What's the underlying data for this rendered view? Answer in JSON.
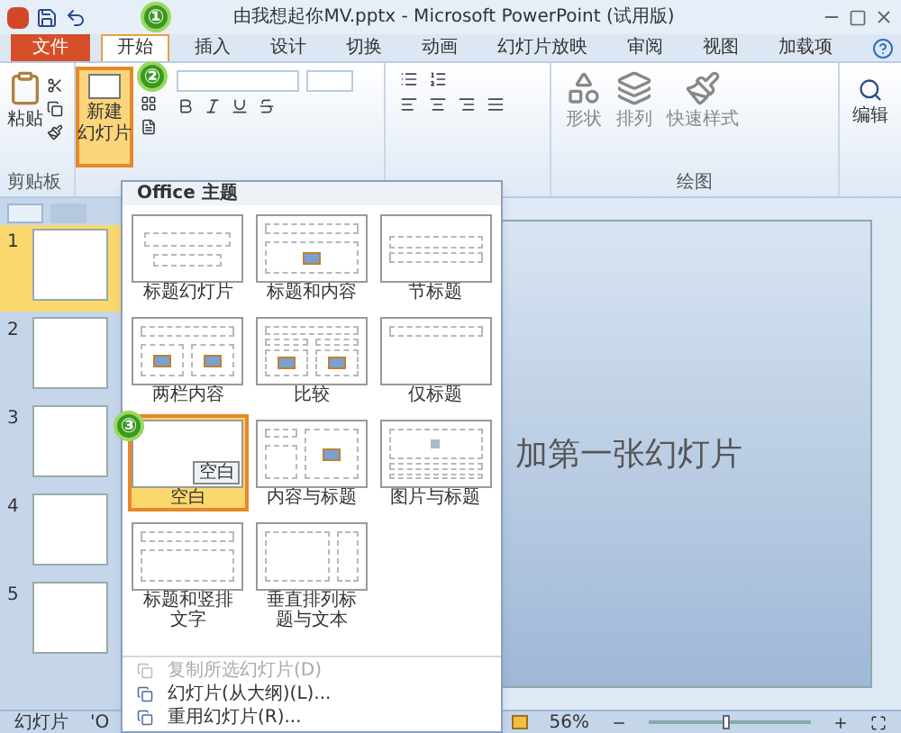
{
  "window": {
    "title": "由我想起你MV.pptx - Microsoft PowerPoint (试用版)"
  },
  "ribbon_tabs": [
    {
      "label": "文件",
      "kind": "file",
      "selected": false
    },
    {
      "label": "开始",
      "kind": "tab",
      "selected": true
    },
    {
      "label": "插入",
      "kind": "tab",
      "selected": false
    },
    {
      "label": "设计",
      "kind": "tab",
      "selected": false
    },
    {
      "label": "切换",
      "kind": "tab",
      "selected": false
    },
    {
      "label": "动画",
      "kind": "tab",
      "selected": false
    },
    {
      "label": "幻灯片放映",
      "kind": "tab",
      "selected": false
    },
    {
      "label": "审阅",
      "kind": "tab",
      "selected": false
    },
    {
      "label": "视图",
      "kind": "tab",
      "selected": false
    },
    {
      "label": "加载项",
      "kind": "tab",
      "selected": false
    }
  ],
  "clipboard_group": {
    "paste": "粘贴",
    "label": "剪贴板"
  },
  "new_slide_button": {
    "lines": [
      "新建",
      "幻灯片"
    ],
    "selected": true
  },
  "drawing_group": {
    "buttons": [
      "形状",
      "排列",
      "快速样式"
    ],
    "label": "绘图"
  },
  "editing_button": "编辑",
  "slide_panel": {
    "slides": [
      {
        "number": "1",
        "selected": true
      },
      {
        "number": "2",
        "selected": false
      },
      {
        "number": "3",
        "selected": false
      },
      {
        "number": "4",
        "selected": false
      },
      {
        "number": "5",
        "selected": false
      }
    ]
  },
  "slide_canvas": {
    "text": "加第一张幻灯片"
  },
  "layout_gallery": {
    "heading": "Office 主题",
    "tooltip": "空白",
    "layouts": [
      {
        "label": "标题幻灯片",
        "kind": "title",
        "selected": false
      },
      {
        "label": "标题和内容",
        "kind": "title_content",
        "selected": false
      },
      {
        "label": "节标题",
        "kind": "section",
        "selected": false
      },
      {
        "label": "两栏内容",
        "kind": "two_content",
        "selected": false
      },
      {
        "label": "比较",
        "kind": "comparison",
        "selected": false
      },
      {
        "label": "仅标题",
        "kind": "title_only",
        "selected": false
      },
      {
        "label": "空白",
        "kind": "blank",
        "selected": true
      },
      {
        "label": "内容与标题",
        "kind": "content_caption",
        "selected": false
      },
      {
        "label": "图片与标题",
        "kind": "picture_caption",
        "selected": false
      },
      {
        "label": "标题和竖排文字",
        "kind": "title_vertical",
        "selected": false
      },
      {
        "label": "垂直排列标题与文本",
        "kind": "vertical_title",
        "selected": false
      }
    ],
    "menu": [
      {
        "label": "复制所选幻灯片(D)",
        "disabled": true
      },
      {
        "label": "幻灯片(从大纲)(L)...",
        "disabled": false
      },
      {
        "label": "重用幻灯片(R)...",
        "disabled": false
      }
    ]
  },
  "annotations": [
    "①",
    "②",
    "③"
  ],
  "status_bar": {
    "slide_label": "幻灯片",
    "theme": "'O",
    "zoom": "56%",
    "zoom_slider": {
      "level": 0.45
    }
  }
}
